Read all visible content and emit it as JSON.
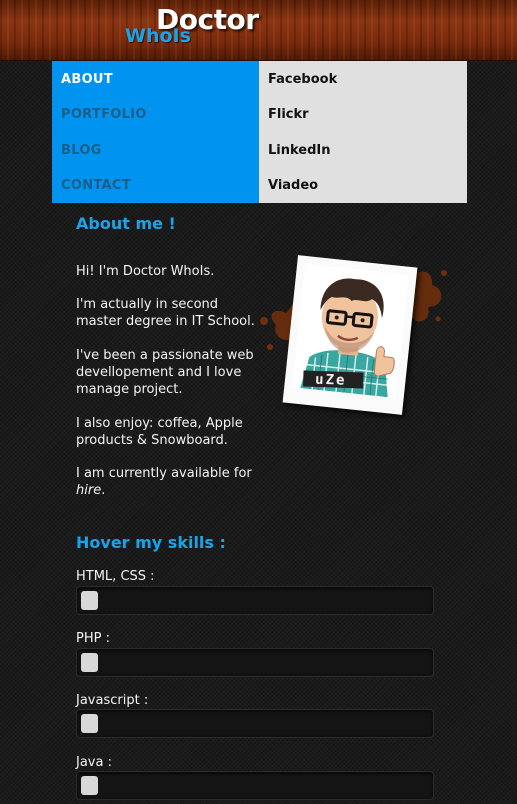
{
  "header": {
    "logo_top": "Doctor",
    "logo_bottom": "WhoIs"
  },
  "nav": {
    "items": [
      {
        "label": "ABOUT",
        "active": true
      },
      {
        "label": "PORTFOLIO",
        "active": false
      },
      {
        "label": "BLOG",
        "active": false
      },
      {
        "label": "CONTACT",
        "active": false
      }
    ],
    "social": [
      {
        "label": "Facebook"
      },
      {
        "label": "Flickr"
      },
      {
        "label": "LinkedIn"
      },
      {
        "label": "Viadeo"
      }
    ]
  },
  "about": {
    "title": "About me !",
    "paragraphs": [
      "Hi! I'm Doctor WhoIs.",
      "I'm actually in second master degree in IT School.",
      "I've been a passionate web devellopement and I love manage project.",
      "I also enjoy: coffea, Apple products & Snowboard.",
      "I am currently available for"
    ],
    "hire_text": "hire",
    "hire_suffix": ".",
    "photo_caption": "uZe"
  },
  "skills": {
    "title": "Hover my skills :",
    "items": [
      {
        "label": "HTML, CSS :",
        "level": 0.05
      },
      {
        "label": "PHP :",
        "level": 0.05
      },
      {
        "label": "Javascript :",
        "level": 0.05
      },
      {
        "label": "Java :",
        "level": 0.05
      }
    ]
  },
  "colors": {
    "accent": "#1aa3e8",
    "nav_active_bg": "#0094f0",
    "social_bg": "#e0e0e0",
    "background": "#1b1b1b"
  }
}
